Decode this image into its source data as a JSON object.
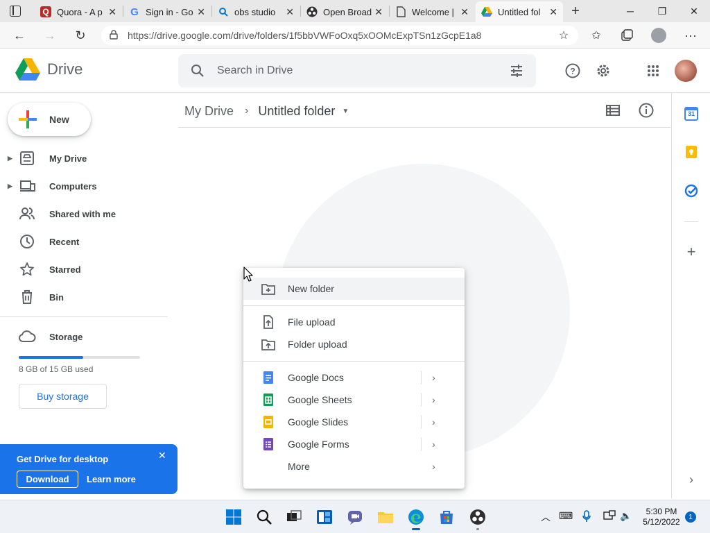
{
  "browser": {
    "tabs": [
      {
        "title": "Quora - A p",
        "icon": "quora-icon",
        "icon_color": "#b92b27"
      },
      {
        "title": "Sign in - Go",
        "icon": "google-icon",
        "icon_color": "#4285f4"
      },
      {
        "title": "obs studio",
        "icon": "bing-search-icon",
        "icon_color": "#0078d4"
      },
      {
        "title": "Open Broad",
        "icon": "obs-icon",
        "icon_color": "#302e31"
      },
      {
        "title": "Welcome |",
        "icon": "page-icon",
        "icon_color": "#5f6368"
      },
      {
        "title": "Untitled fol",
        "icon": "google-drive-icon",
        "icon_color": "#1a73e8"
      }
    ],
    "url": "https://drive.google.com/drive/folders/1f5bbVWFoOxq5xOOMcExpTSn1zGcpE1a8"
  },
  "header": {
    "app_name": "Drive",
    "search_placeholder": "Search in Drive"
  },
  "sidebar": {
    "new_label": "New",
    "items": [
      {
        "label": "My Drive"
      },
      {
        "label": "Computers"
      },
      {
        "label": "Shared with me"
      },
      {
        "label": "Recent"
      },
      {
        "label": "Starred"
      },
      {
        "label": "Bin"
      }
    ],
    "storage_label": "Storage",
    "storage_used_text": "8 GB of 15 GB used",
    "storage_fraction": 0.53,
    "buy_storage_label": "Buy storage"
  },
  "promo": {
    "title": "Get Drive for desktop",
    "download_label": "Download",
    "learn_more_label": "Learn more"
  },
  "breadcrumb": {
    "root": "My Drive",
    "current": "Untitled folder"
  },
  "context_menu": {
    "items": [
      {
        "label": "New folder",
        "icon": "new-folder-icon"
      },
      {
        "label": "File upload",
        "icon": "file-upload-icon"
      },
      {
        "label": "Folder upload",
        "icon": "folder-upload-icon"
      },
      {
        "label": "Google Docs",
        "icon": "google-docs-icon",
        "color": "#4285f4"
      },
      {
        "label": "Google Sheets",
        "icon": "google-sheets-icon",
        "color": "#0f9d58"
      },
      {
        "label": "Google Slides",
        "icon": "google-slides-icon",
        "color": "#f4b400"
      },
      {
        "label": "Google Forms",
        "icon": "google-forms-icon",
        "color": "#7248b9"
      },
      {
        "label": "More",
        "icon": ""
      }
    ]
  },
  "right_panel": {
    "calendar_day": "31"
  },
  "taskbar": {
    "time": "5:30 PM",
    "date": "5/12/2022",
    "notifications": "1"
  },
  "colors": {
    "accent": "#1a73e8",
    "drive_blue": "#4285f4",
    "drive_green": "#0f9d58",
    "drive_yellow": "#f4b400",
    "drive_red": "#db4437"
  }
}
